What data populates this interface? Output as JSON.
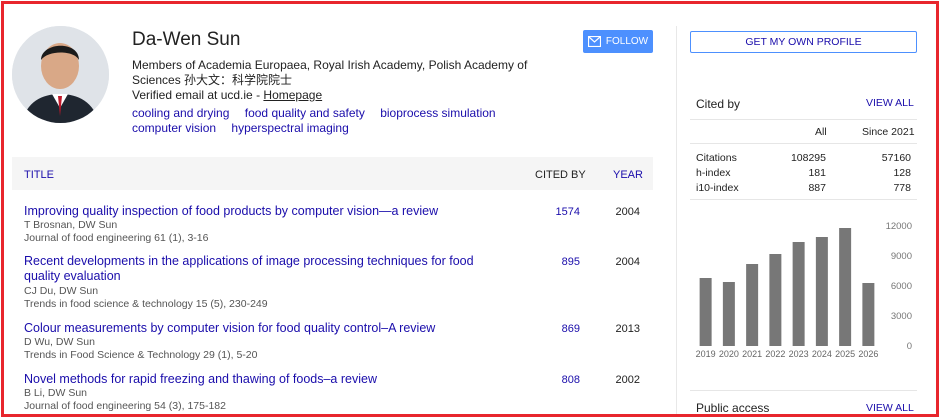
{
  "profile": {
    "name": "Da-Wen Sun",
    "affiliation": "Members of Academia Europaea, Royal Irish Academy, Polish Academy of Sciences 孙大文：科学院院士",
    "email_text": "Verified email at ucd.ie - ",
    "homepage_label": "Homepage",
    "interests": [
      "cooling and drying",
      "food quality and safety",
      "bioprocess simulation",
      "computer vision",
      "hyperspectral imaging"
    ],
    "follow_label": "FOLLOW"
  },
  "table": {
    "col_title": "TITLE",
    "col_cited": "CITED BY",
    "col_year": "YEAR",
    "rows": [
      {
        "title": "Improving quality inspection of food products by computer vision—a review",
        "authors": "T Brosnan, DW Sun",
        "journal": "Journal of food engineering 61 (1), 3-16",
        "cited": "1574",
        "year": "2004"
      },
      {
        "title": "Recent developments in the applications of image processing techniques for food quality evaluation",
        "authors": "CJ Du, DW Sun",
        "journal": "Trends in food science & technology 15 (5), 230-249",
        "cited": "895",
        "year": "2004"
      },
      {
        "title": "Colour measurements by computer vision for food quality control–A review",
        "authors": "D Wu, DW Sun",
        "journal": "Trends in Food Science & Technology 29 (1), 5-20",
        "cited": "869",
        "year": "2013"
      },
      {
        "title": "Novel methods for rapid freezing and thawing of foods–a review",
        "authors": "B Li, DW Sun",
        "journal": "Journal of food engineering 54 (3), 175-182",
        "cited": "808",
        "year": "2002"
      }
    ]
  },
  "sidebar": {
    "get_profile_label": "GET MY OWN PROFILE",
    "cited_by_label": "Cited by",
    "view_all_label": "VIEW ALL",
    "col_all": "All",
    "col_since": "Since 2021",
    "stats": [
      {
        "label": "Citations",
        "all": "108295",
        "since": "57160"
      },
      {
        "label": "h-index",
        "all": "181",
        "since": "128"
      },
      {
        "label": "i10-index",
        "all": "887",
        "since": "778"
      }
    ],
    "public_access_label": "Public access"
  },
  "chart_data": {
    "type": "bar",
    "categories": [
      "2019",
      "2020",
      "2021",
      "2022",
      "2023",
      "2024",
      "2025",
      "2026"
    ],
    "values": [
      6800,
      6400,
      8200,
      9200,
      10400,
      10900,
      11800,
      6300
    ],
    "ylim": [
      0,
      12000
    ],
    "yticks": [
      "12000",
      "9000",
      "6000",
      "3000",
      "0"
    ],
    "bar_color": "#777777"
  },
  "colors": {
    "link": "#1a0dab",
    "accent": "#4d90fe",
    "frame": "#e8262d"
  }
}
